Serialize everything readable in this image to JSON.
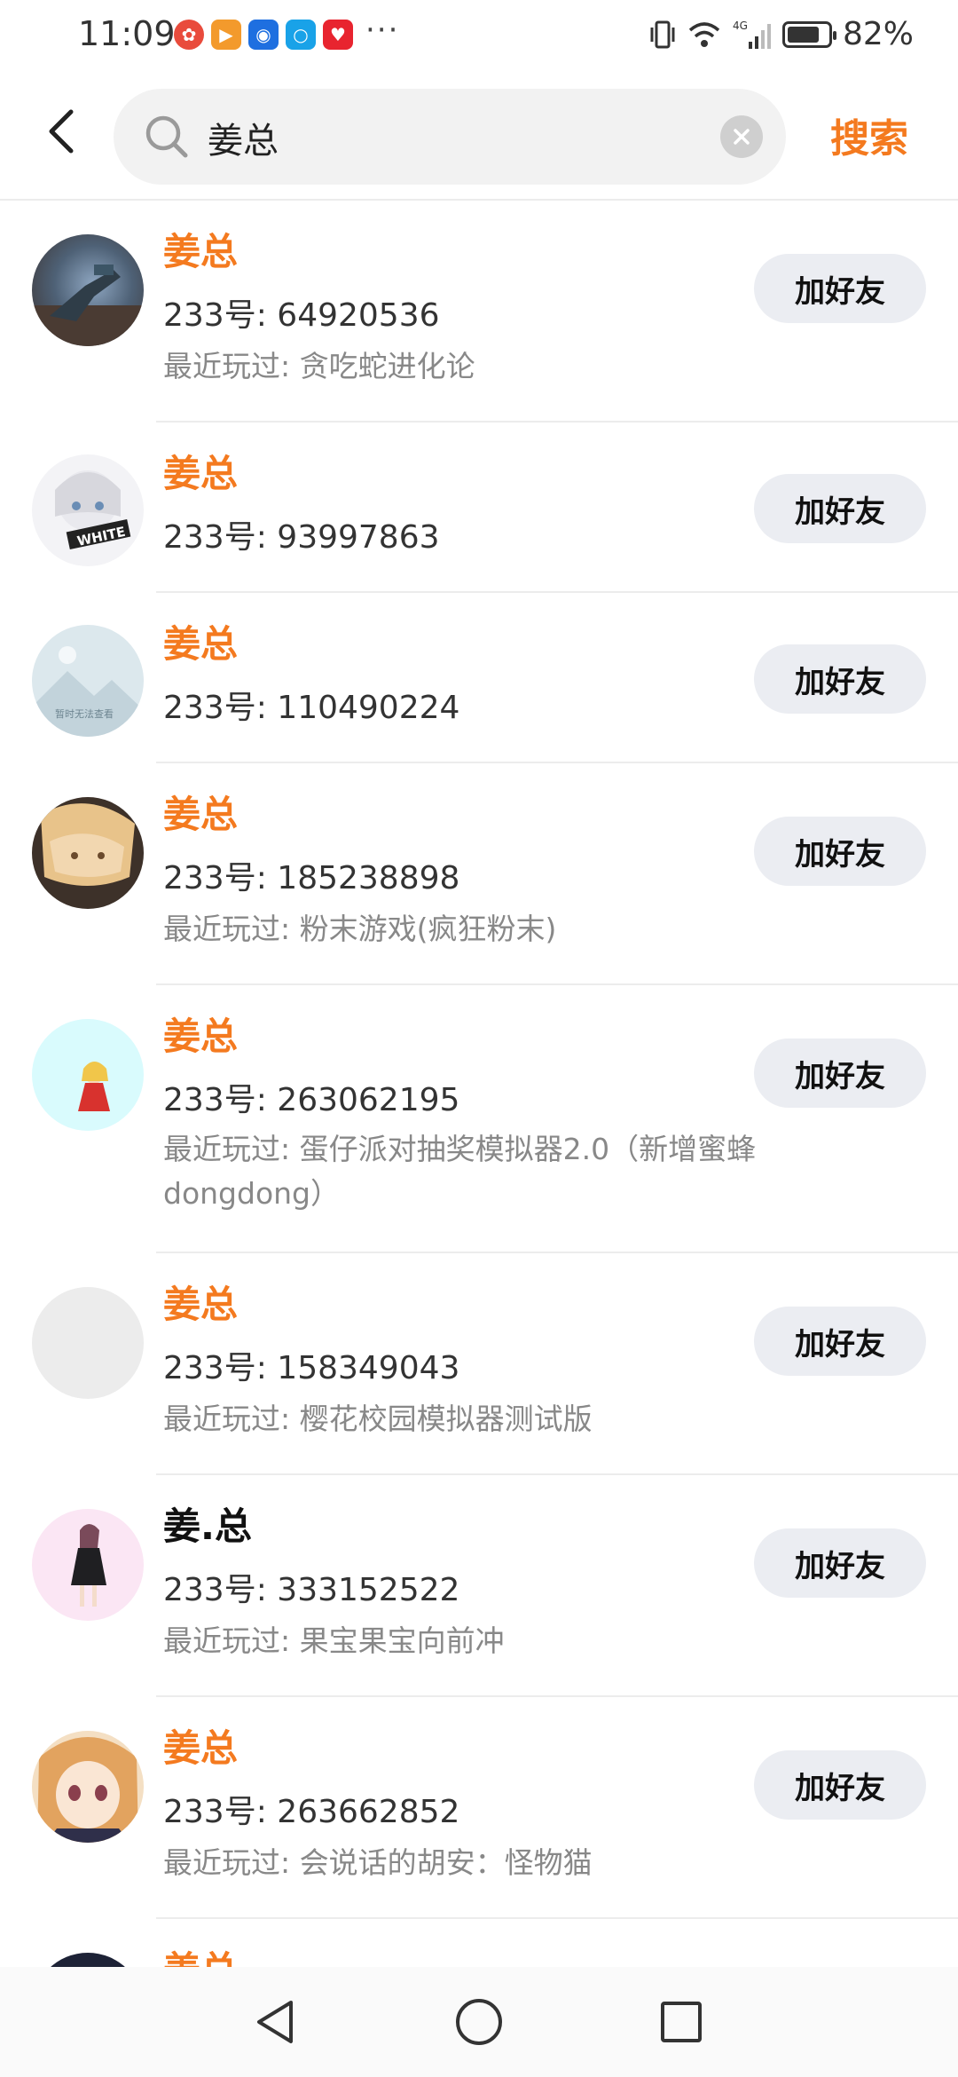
{
  "status_bar": {
    "time": "11:09",
    "more_indicator": "···",
    "battery_text": "82%",
    "battery_level": 0.82,
    "icons": [
      "vibrate-icon",
      "wifi-icon",
      "signal-4g-icon",
      "battery-icon"
    ],
    "app_icons": [
      {
        "name": "app-pinwheel-icon",
        "color": "#e94b3c"
      },
      {
        "name": "app-video-icon",
        "color": "#f39a2c"
      },
      {
        "name": "app-bulb-icon",
        "color": "#1e6fe0"
      },
      {
        "name": "app-search-icon",
        "color": "#19a2e8"
      },
      {
        "name": "app-heart-icon",
        "color": "#e8242f"
      }
    ]
  },
  "header": {
    "query": "姜总",
    "search_label": "搜索"
  },
  "colors": {
    "accent": "#f47a1f",
    "button_bg": "#ebedf2"
  },
  "results": [
    {
      "name": "姜总",
      "id": "233号: 64920536",
      "played": "最近玩过: 贪吃蛇进化论",
      "add": "加好友"
    },
    {
      "name": "姜总",
      "id": "233号: 93997863",
      "played": "",
      "add": "加好友",
      "avatar_text": "WHITE"
    },
    {
      "name": "姜总",
      "id": "233号: 110490224",
      "played": "",
      "add": "加好友",
      "avatar_text": "暂时无法查看"
    },
    {
      "name": "姜总",
      "id": "233号: 185238898",
      "played": "最近玩过: 粉末游戏(疯狂粉末)",
      "add": "加好友"
    },
    {
      "name": "姜总",
      "id": "233号: 263062195",
      "played": "最近玩过: 蛋仔派对抽奖模拟器2.0（新增蜜蜂dongdong）",
      "add": "加好友"
    },
    {
      "name": "姜总",
      "id": "233号: 158349043",
      "played": "最近玩过: 樱花校园模拟器测试版",
      "add": "加好友"
    },
    {
      "name": "姜.总",
      "id": "233号: 333152522",
      "played": "最近玩过: 果宝果宝向前冲",
      "add": "加好友"
    },
    {
      "name": "姜总",
      "id": "233号: 263662852",
      "played": "最近玩过: 会说话的胡安：怪物猫",
      "add": "加好友"
    },
    {
      "name": "姜总",
      "id": "",
      "played": "",
      "add": ""
    }
  ],
  "nav": {
    "icons": [
      "back-triangle-icon",
      "home-circle-icon",
      "recents-square-icon"
    ]
  }
}
